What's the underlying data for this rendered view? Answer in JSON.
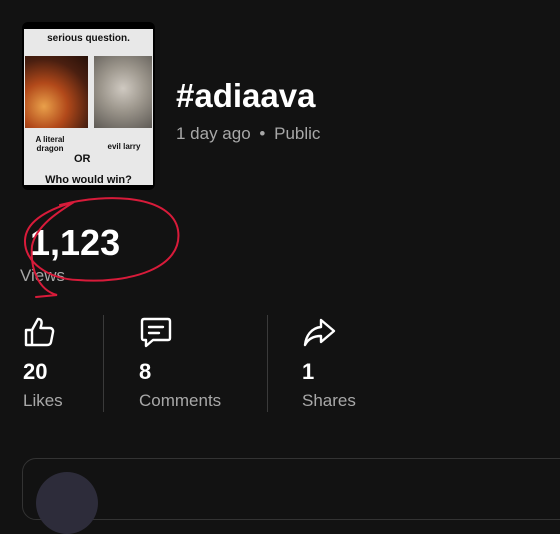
{
  "thumbnail": {
    "top_text": "serious question.",
    "left_caption": "A literal dragon",
    "right_caption": "evil larry",
    "middle_text": "OR",
    "bottom_text": "Who would win?"
  },
  "post": {
    "title": "#adiaava",
    "age": "1 day ago",
    "separator": "•",
    "visibility": "Public"
  },
  "views": {
    "count": "1,123",
    "label": "Views"
  },
  "stats": [
    {
      "value": "20",
      "label": "Likes",
      "icon": "thumbs-up-icon"
    },
    {
      "value": "8",
      "label": "Comments",
      "icon": "comment-icon"
    },
    {
      "value": "1",
      "label": "Shares",
      "icon": "share-icon"
    }
  ],
  "colors": {
    "background": "#121212",
    "text": "#ffffff",
    "muted": "#a8a8a8",
    "annotation": "#d81b3a"
  }
}
